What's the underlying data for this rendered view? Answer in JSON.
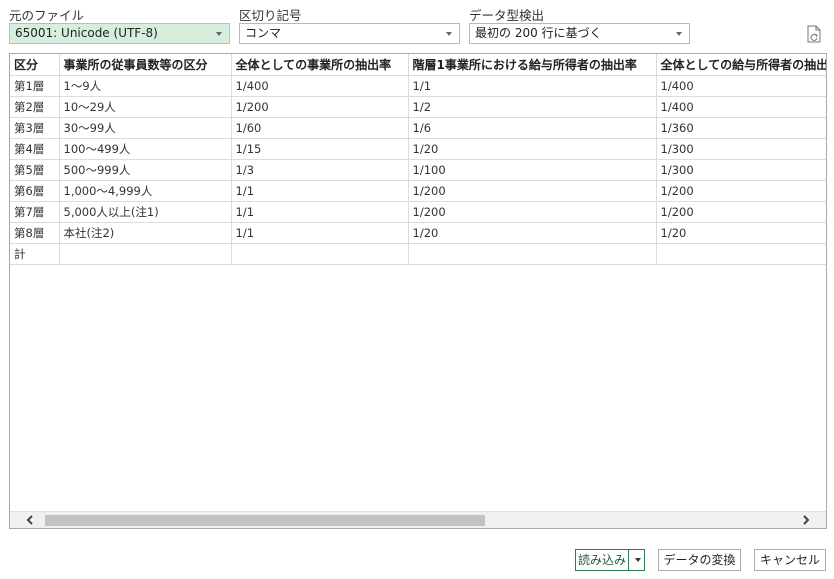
{
  "source_file": {
    "label": "元のファイル",
    "value": "65001: Unicode (UTF-8)"
  },
  "delimiter": {
    "label": "区切り記号",
    "value": "コンマ"
  },
  "type_detection": {
    "label": "データ型検出",
    "value": "最初の 200 行に基づく"
  },
  "refresh_icon": "refresh-document-icon",
  "table": {
    "headers": [
      "区分",
      "事業所の従事員数等の区分",
      "全体としての事業所の抽出率",
      "階層1事業所における給与所得者の抽出率",
      "全体としての給与所得者の抽出率"
    ],
    "rows": [
      [
        "第1層",
        "1～9人",
        "1/400",
        "1/1",
        "1/400"
      ],
      [
        "第2層",
        "10～29人",
        "1/200",
        "1/2",
        "1/400"
      ],
      [
        "第3層",
        "30～99人",
        "1/60",
        "1/6",
        "1/360"
      ],
      [
        "第4層",
        "100～499人",
        "1/15",
        "1/20",
        "1/300"
      ],
      [
        "第5層",
        "500～999人",
        "1/3",
        "1/100",
        "1/300"
      ],
      [
        "第6層",
        "1,000～4,999人",
        "1/1",
        "1/200",
        "1/200"
      ],
      [
        "第7層",
        "5,000人以上(注1)",
        "1/1",
        "1/200",
        "1/200"
      ],
      [
        "第8層",
        "本社(注2)",
        "1/1",
        "1/20",
        "1/20"
      ],
      [
        "計",
        "",
        "",
        "",
        ""
      ]
    ]
  },
  "buttons": {
    "load": "読み込み",
    "transform": "データの変換",
    "cancel": "キャンセル"
  },
  "colors": {
    "selected_bg": "#d6efdc",
    "load_border": "#2e7d4f"
  }
}
